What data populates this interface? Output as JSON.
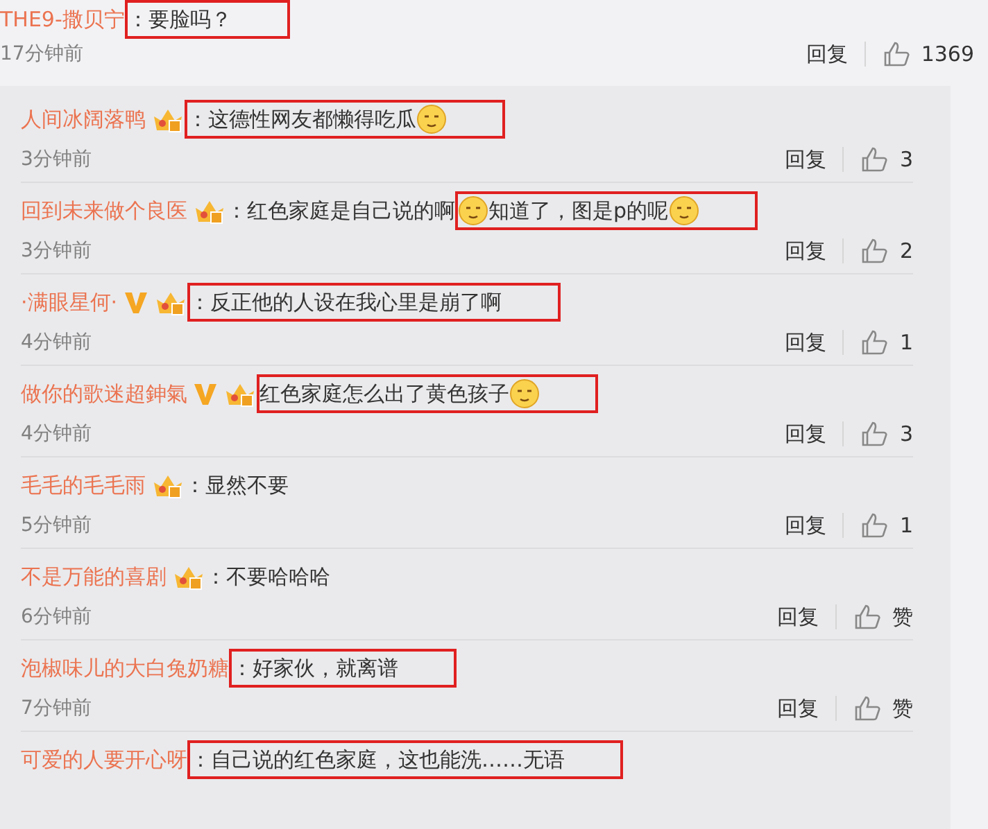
{
  "main_comment": {
    "user": "THE9-撒贝宁",
    "segments": [
      {
        "highlighted": true,
        "parts": [
          {
            "kind": "text",
            "text": "：要脸吗？"
          }
        ]
      }
    ],
    "time": "17分钟前",
    "reply_label": "回复",
    "likes": "1369"
  },
  "replies": [
    {
      "user": "人间冰阔落鸭",
      "badges": [
        {
          "kind": "crown"
        }
      ],
      "segments": [
        {
          "highlighted": true,
          "parts": [
            {
              "kind": "text",
              "text": "：这德性网友都懒得吃瓜"
            },
            {
              "kind": "emoji"
            }
          ]
        }
      ],
      "time": "3分钟前",
      "reply_label": "回复",
      "likes": "3"
    },
    {
      "user": "回到未来做个良医",
      "badges": [
        {
          "kind": "crown"
        }
      ],
      "segments": [
        {
          "highlighted": false,
          "parts": [
            {
              "kind": "text",
              "text": "：红色家庭是自己说的啊"
            }
          ]
        },
        {
          "highlighted": true,
          "parts": [
            {
              "kind": "emoji"
            },
            {
              "kind": "text",
              "text": "知道了，图是p的呢"
            },
            {
              "kind": "emoji"
            }
          ]
        }
      ],
      "time": "3分钟前",
      "reply_label": "回复",
      "likes": "2"
    },
    {
      "user": "·满眼星何·",
      "badges": [
        {
          "kind": "vip"
        },
        {
          "kind": "crown"
        }
      ],
      "segments": [
        {
          "highlighted": true,
          "parts": [
            {
              "kind": "text",
              "text": "：反正他的人设在我心里是崩了啊"
            }
          ]
        }
      ],
      "time": "4分钟前",
      "reply_label": "回复",
      "likes": "1"
    },
    {
      "user": "做你的歌迷超鉮氣",
      "badges": [
        {
          "kind": "vip"
        },
        {
          "kind": "crown"
        }
      ],
      "segments": [
        {
          "highlighted": true,
          "parts": [
            {
              "kind": "text",
              "text": "红色家庭怎么出了黄色孩子"
            },
            {
              "kind": "emoji"
            }
          ]
        }
      ],
      "time": "4分钟前",
      "reply_label": "回复",
      "likes": "3"
    },
    {
      "user": "毛毛的毛毛雨",
      "badges": [
        {
          "kind": "crown"
        }
      ],
      "segments": [
        {
          "highlighted": false,
          "parts": [
            {
              "kind": "text",
              "text": "：显然不要"
            }
          ]
        }
      ],
      "time": "5分钟前",
      "reply_label": "回复",
      "likes": "1"
    },
    {
      "user": "不是万能的喜剧",
      "badges": [
        {
          "kind": "crown"
        }
      ],
      "segments": [
        {
          "highlighted": false,
          "parts": [
            {
              "kind": "text",
              "text": "：不要哈哈哈"
            }
          ]
        }
      ],
      "time": "6分钟前",
      "reply_label": "回复",
      "likes": "赞"
    },
    {
      "user": "泡椒味儿的大白兔奶糖",
      "segments": [
        {
          "highlighted": true,
          "parts": [
            {
              "kind": "text",
              "text": "：好家伙，就离谱"
            }
          ]
        }
      ],
      "time": "7分钟前",
      "reply_label": "回复",
      "likes": "赞"
    },
    {
      "user": "可爱的人要开心呀",
      "segments": [
        {
          "highlighted": true,
          "parts": [
            {
              "kind": "text",
              "text": "：自己说的红色家庭，这也能洗……无语"
            }
          ]
        }
      ]
    }
  ]
}
